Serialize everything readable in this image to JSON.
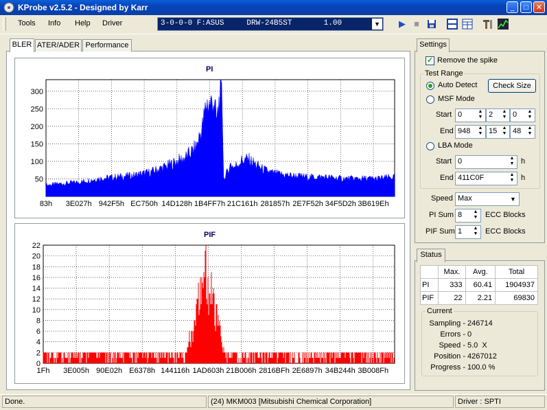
{
  "window": {
    "title": "KProbe v2.5.2 - Designed by Karr"
  },
  "menu": [
    "Tools",
    "Info",
    "Help",
    "Driver"
  ],
  "drive": {
    "selected": "3-0-0-0 F:ASUS     DRW-24B5ST       1.00"
  },
  "tabs": [
    "BLER",
    "ATER/ADER",
    "Performance"
  ],
  "settings_tab": "Settings",
  "settings": {
    "remove_spike": "Remove the spike",
    "test_range": "Test Range",
    "auto_detect": "Auto Detect",
    "check_size": "Check Size",
    "msf_mode": "MSF Mode",
    "start_label": "Start",
    "end_label": "End",
    "msf_start": [
      "0",
      "2",
      "0"
    ],
    "msf_end": [
      "948",
      "15",
      "48"
    ],
    "lba_mode": "LBA Mode",
    "lba_start": "0",
    "lba_end": "411C0F",
    "h": "h",
    "speed_label": "Speed",
    "speed_value": "Max",
    "pi_sum_label": "PI Sum",
    "pi_sum_value": "8",
    "pif_sum_label": "PIF Sum",
    "pif_sum_value": "1",
    "ecc_blocks": "ECC Blocks"
  },
  "status_tab": "Status",
  "stats": {
    "headers": [
      "",
      "Max.",
      "Avg.",
      "Total"
    ],
    "rows": [
      [
        "PI",
        "333",
        "60.41",
        "1904937"
      ],
      [
        "PIF",
        "22",
        "2.21",
        "69830"
      ]
    ]
  },
  "current": {
    "label": "Current",
    "sampling_label": "Sampling -",
    "sampling": "246714",
    "errors_label": "Errors -",
    "errors": "0",
    "speed_label": "Speed -",
    "speed": "5.0  X",
    "position_label": "Position -",
    "position": "4267012",
    "progress_label": "Progress -",
    "progress": "100.0 %"
  },
  "statusbar": {
    "left": "Done.",
    "middle": "(24) MKM003 [Mitsubishi Chemical Corporation]",
    "right": "Driver : SPTI"
  },
  "chart_data": [
    {
      "type": "area",
      "title": "PI",
      "color": "#0000FF",
      "ylim": [
        0,
        333
      ],
      "yticks": [
        50,
        100,
        150,
        200,
        250,
        300
      ],
      "xticks": [
        "83h",
        "3E027h",
        "942F5h",
        "EC750h",
        "14D128h",
        "1B4FF7h",
        "21C161h",
        "281857h",
        "2E7F52h",
        "34F5D2h",
        "3B619Eh"
      ],
      "x_fraction": [
        0,
        0.05,
        0.1,
        0.15,
        0.2,
        0.25,
        0.3,
        0.35,
        0.4,
        0.43,
        0.45,
        0.46,
        0.47,
        0.48,
        0.49,
        0.5,
        0.505,
        0.51,
        0.52,
        0.53,
        0.54,
        0.55,
        0.56,
        0.58,
        0.6,
        0.62,
        0.64,
        0.66,
        0.7,
        0.75,
        0.8,
        0.85,
        0.9,
        0.95,
        1.0
      ],
      "values": [
        35,
        40,
        45,
        55,
        60,
        65,
        75,
        95,
        120,
        150,
        220,
        290,
        280,
        300,
        230,
        330,
        300,
        50,
        75,
        100,
        90,
        100,
        110,
        115,
        100,
        85,
        75,
        70,
        65,
        60,
        60,
        55,
        55,
        55,
        60
      ]
    },
    {
      "type": "bar",
      "title": "PIF",
      "color": "#FF0000",
      "ylim": [
        0,
        22
      ],
      "yticks": [
        0,
        2,
        4,
        6,
        8,
        10,
        12,
        14,
        16,
        18,
        20,
        22
      ],
      "xticks": [
        "1Fh",
        "3E005h",
        "90E02h",
        "E6378h",
        "144116h",
        "1AD603h",
        "21B006h",
        "2816BFh",
        "2E6897h",
        "34B244h",
        "3B008Fh"
      ],
      "x_fraction": [
        0,
        0.1,
        0.2,
        0.3,
        0.4,
        0.43,
        0.45,
        0.46,
        0.47,
        0.48,
        0.49,
        0.5,
        0.51,
        0.52,
        0.6,
        0.7,
        0.8,
        0.9,
        1.0
      ],
      "values": [
        2,
        2,
        2,
        2,
        2,
        8,
        20,
        22,
        18,
        16,
        10,
        12,
        4,
        2,
        2,
        2,
        2,
        2,
        2
      ]
    }
  ]
}
